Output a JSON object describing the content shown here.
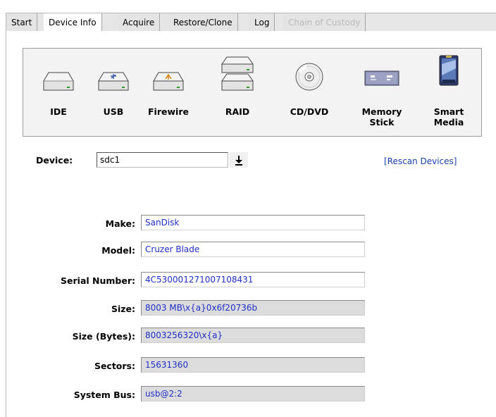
{
  "tabs": [
    {
      "label": "Start",
      "state": "normal"
    },
    {
      "label": "Device Info",
      "state": "active"
    },
    {
      "label": "Acquire",
      "state": "normal"
    },
    {
      "label": "Restore/Clone",
      "state": "normal"
    },
    {
      "label": "Log",
      "state": "normal"
    },
    {
      "label": "Chain of Custody",
      "state": "disabled"
    }
  ],
  "device_types": [
    {
      "label": "IDE",
      "icon": "ide-drive-icon"
    },
    {
      "label": "USB",
      "icon": "usb-drive-icon"
    },
    {
      "label": "Firewire",
      "icon": "firewire-drive-icon"
    },
    {
      "label": "RAID",
      "icon": "raid-drives-icon"
    },
    {
      "label": "CD/DVD",
      "icon": "cd-dvd-icon"
    },
    {
      "label": "Memory\nStick",
      "icon": "memory-stick-icon"
    },
    {
      "label": "Smart\nMedia",
      "icon": "smart-media-icon"
    }
  ],
  "device": {
    "label": "Device:",
    "value": "sdc1",
    "rescan_label": "[Rescan Devices]"
  },
  "info": {
    "make": {
      "label": "Make:",
      "value": "SanDisk"
    },
    "model": {
      "label": "Model:",
      "value": "Cruzer Blade"
    },
    "serial": {
      "label": "Serial Number:",
      "value": "4C530001271007108431"
    },
    "size": {
      "label": "Size:",
      "value": "8003 MB\\x{a}0x6f20736b"
    },
    "size_bytes": {
      "label": "Size (Bytes):",
      "value": "8003256320\\x{a}"
    },
    "sectors": {
      "label": "Sectors:",
      "value": "15631360"
    },
    "system_bus": {
      "label": "System Bus:",
      "value": "usb@2:2"
    }
  },
  "colors": {
    "field_text": "#1f2ec9",
    "link": "#1a3fb0",
    "readonly_bg": "#dcdcdc"
  }
}
